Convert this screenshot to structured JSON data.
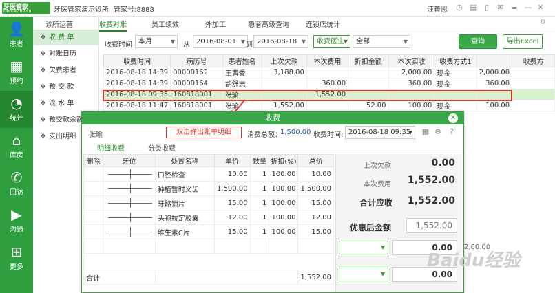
{
  "app": {
    "logo_main": "牙医管家",
    "logo_sub": "Dental360.cn",
    "clinic": "牙医管家演示诊所",
    "account": "管家号:8888",
    "user": "汪善思"
  },
  "sidebar": {
    "items": [
      {
        "label": "患者",
        "icon": "person-icon"
      },
      {
        "label": "预约",
        "icon": "calendar-icon"
      },
      {
        "label": "统计",
        "icon": "pie-chart-icon"
      },
      {
        "label": "库房",
        "icon": "warehouse-icon"
      },
      {
        "label": "回访",
        "icon": "phone-icon"
      },
      {
        "label": "沟通",
        "icon": "play-icon"
      },
      {
        "label": "更多",
        "icon": "grid-icon"
      }
    ]
  },
  "subnav": {
    "items": [
      "收 费 单",
      "对账日历",
      "欠费患者",
      "预 交 款",
      "流 水 单",
      "预交款余额",
      "支出明细"
    ]
  },
  "tabs": [
    "诊所运营",
    "收费对账",
    "员工绩效",
    "外加工",
    "患者高级查询",
    "连锁店统计"
  ],
  "filters": {
    "time_label": "收费时间",
    "period": "本月",
    "from_label": "从",
    "start_date": "2016-08-01",
    "to_label": "到",
    "end_date": "2016-08-18",
    "doctor": "收费医生",
    "doctor_value": "全部",
    "query_button": "查询",
    "export_button": "导出Excel"
  },
  "grid": {
    "columns": [
      "收费时间",
      "病历号",
      "患者姓名",
      "上次欠款",
      "本次费用",
      "折扣金额",
      "本次实收",
      "收费方式1",
      "",
      "收费方"
    ],
    "rows": [
      [
        "2016-08-18 14:39",
        "00000162",
        "王曹黍",
        "3,188.00",
        "",
        "",
        "2,000.00",
        "现金",
        "2,000.00",
        ""
      ],
      [
        "2016-08-18 14:39",
        "00000164",
        "胡舒志",
        "",
        "360.00",
        "",
        "360.00",
        "现金",
        "360.00",
        ""
      ],
      [
        "2016-08-18 09:35",
        "160818001",
        "张瑜",
        "",
        "1,552.00",
        "",
        "",
        "",
        "",
        ""
      ],
      [
        "2016-08-18 11:47",
        "160818001",
        "张瑜",
        "1,552.00",
        "",
        "52.00",
        "100.00",
        "现金",
        "100.00",
        ""
      ]
    ]
  },
  "modal": {
    "title": "收费",
    "patient": "张瑜",
    "annotation": "双击弹出账单明细",
    "total_label": "消费总额：",
    "total_value": "1,500.00",
    "time_label": "收费时间:",
    "time_value": "2016-08-18  09:35",
    "tabs": [
      "明细收费",
      "分类收费"
    ],
    "columns": [
      "删除",
      "牙位",
      "处置名称",
      "单价",
      "数量",
      "折扣(%)",
      "总价"
    ],
    "items": [
      [
        "",
        "",
        "口腔检查",
        "10.00",
        "1",
        "100.00",
        "10.00"
      ],
      [
        "",
        "",
        "种植暂时义齿",
        "1,500.00",
        "1",
        "100.00",
        "1,500.00"
      ],
      [
        "",
        "",
        "牙骼锁片",
        "15.00",
        "1",
        "100.00",
        "15.00"
      ],
      [
        "",
        "",
        "头孢拉定胶囊",
        "12.00",
        "1",
        "100.00",
        "12.00"
      ],
      [
        "",
        "",
        "维生素C片",
        "15.00",
        "1",
        "100.00",
        "15.00"
      ],
      [
        "",
        "",
        "",
        "",
        "",
        "",
        ""
      ]
    ],
    "sum_label": "合计",
    "sum_value": "1,552.00",
    "summary": {
      "prev_debt_label": "上次欠款",
      "prev_debt": "0.00",
      "this_fee_label": "本次费用",
      "this_fee": "1,552.00",
      "total_due_label": "合计应收",
      "total_due": "1,552.00",
      "discounted_label": "优惠后金额",
      "discounted": "1,552.00",
      "pay1": "0.00",
      "pay2": "0.00",
      "behind_value": "2,60.00"
    }
  },
  "watermark": "Baidu经验"
}
